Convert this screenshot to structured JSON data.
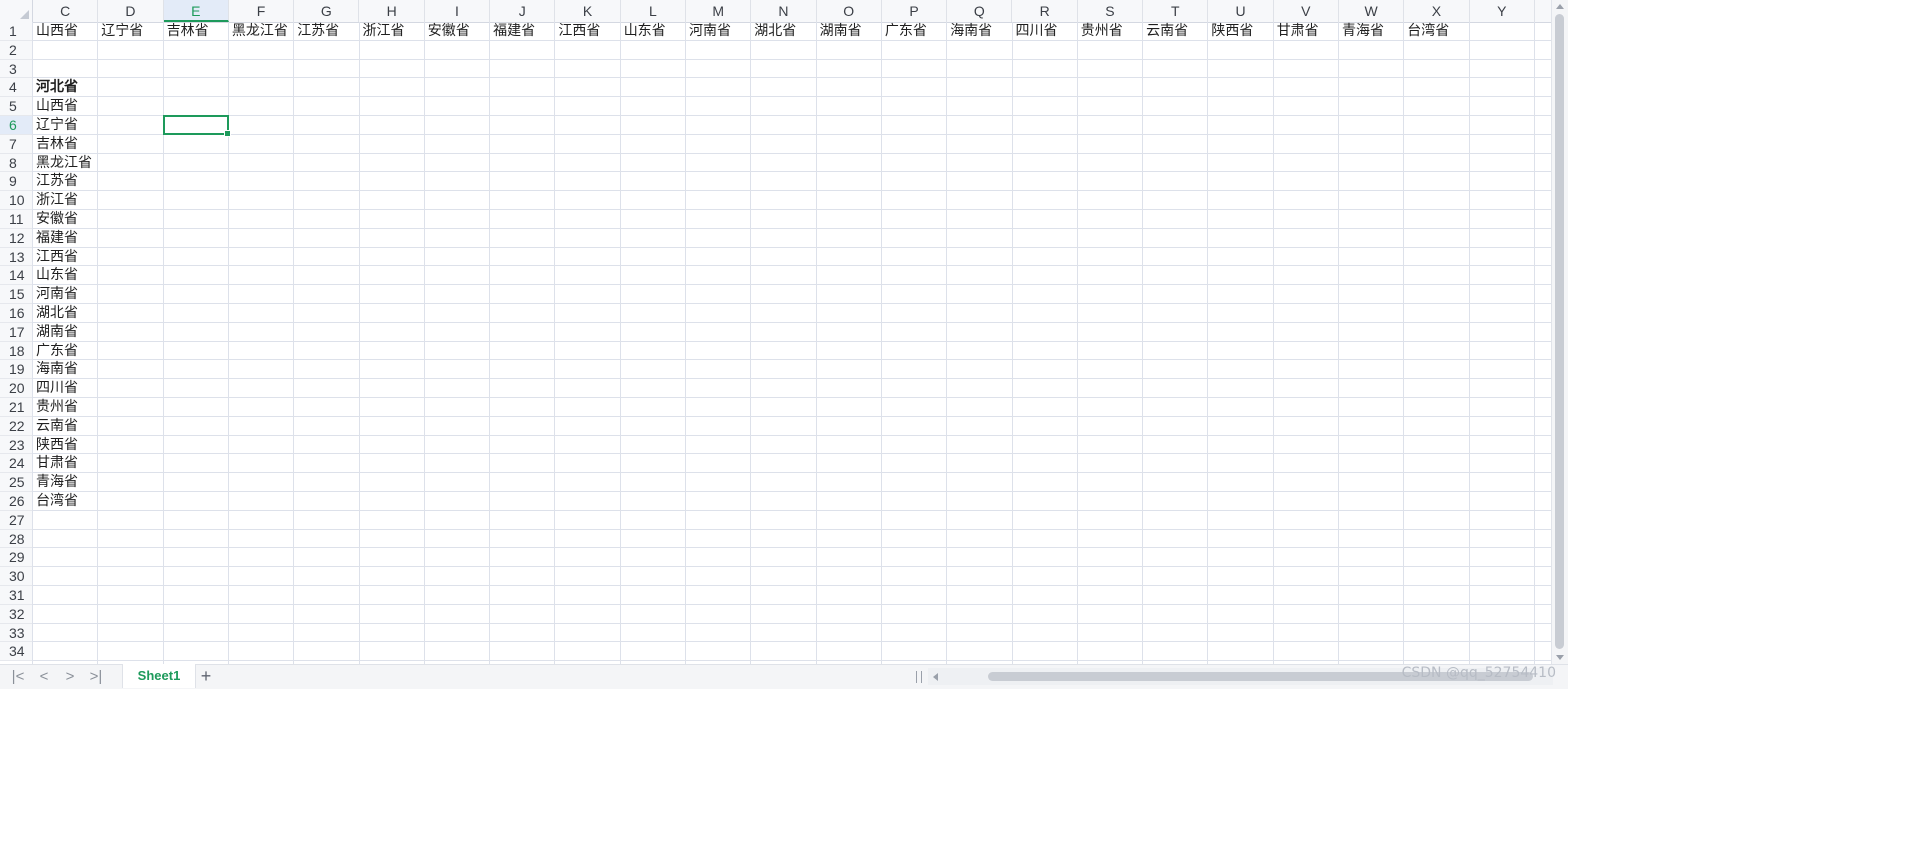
{
  "columns": [
    "C",
    "D",
    "E",
    "F",
    "G",
    "H",
    "I",
    "J",
    "K",
    "L",
    "M",
    "N",
    "O",
    "P",
    "Q",
    "R",
    "S",
    "T",
    "U",
    "V",
    "W",
    "X",
    "Y"
  ],
  "active_column": "E",
  "active_row": 6,
  "visible_rows": [
    1,
    2,
    3,
    4,
    5,
    6,
    7,
    8,
    9,
    10,
    11,
    12,
    13,
    14,
    15,
    16,
    17,
    18,
    19,
    20,
    21,
    22,
    23,
    24,
    25,
    26,
    27,
    28,
    29,
    30,
    31,
    32,
    33,
    34
  ],
  "row1_values": [
    "山西省",
    "辽宁省",
    "吉林省",
    "黑龙江省",
    "江苏省",
    "浙江省",
    "安徽省",
    "福建省",
    "江西省",
    "山东省",
    "河南省",
    "湖北省",
    "湖南省",
    "广东省",
    "海南省",
    "四川省",
    "贵州省",
    "云南省",
    "陕西省",
    "甘肃省",
    "青海省",
    "台湾省"
  ],
  "columnC_values": {
    "4": "河北省",
    "5": "山西省",
    "6": "辽宁省",
    "7": "吉林省",
    "8": "黑龙江省",
    "9": "江苏省",
    "10": "浙江省",
    "11": "安徽省",
    "12": "福建省",
    "13": "江西省",
    "14": "山东省",
    "15": "河南省",
    "16": "湖北省",
    "17": "湖南省",
    "18": "广东省",
    "19": "海南省",
    "20": "四川省",
    "21": "贵州省",
    "22": "云南省",
    "23": "陕西省",
    "24": "甘肃省",
    "25": "青海省",
    "26": "台湾省"
  },
  "bold_cells": [
    "C4"
  ],
  "sheet_tabs": [
    {
      "label": "Sheet1",
      "active": true
    }
  ],
  "tab_nav": {
    "first": "|<",
    "prev": "<",
    "next": ">",
    "last": ">|"
  },
  "add_sheet_label": "+",
  "watermark": "CSDN @qq_52754410",
  "colors": {
    "accent": "#1d9a5b",
    "gridline": "#dde1ea",
    "header_bg": "#f7f8fa"
  }
}
